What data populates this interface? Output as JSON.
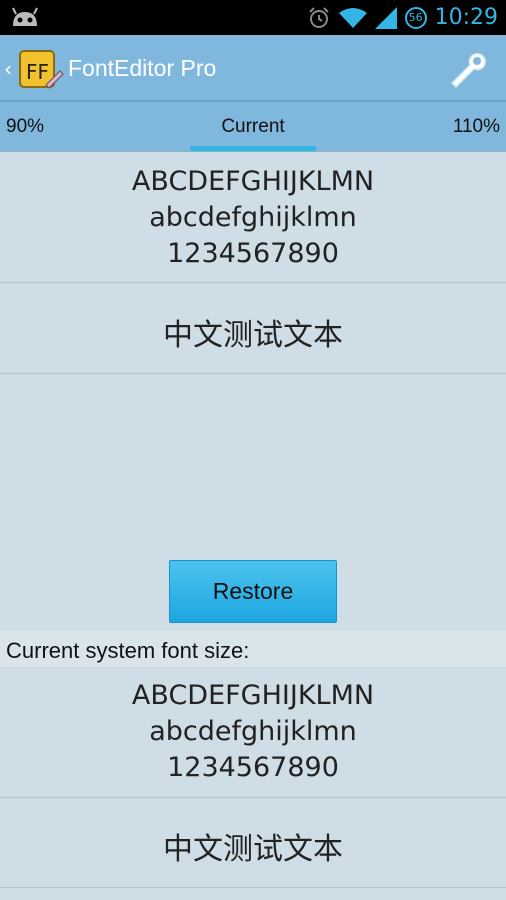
{
  "status_bar": {
    "time": "10:29",
    "battery_badge": "56",
    "icons": [
      "android-icon",
      "alarm-icon",
      "wifi-icon",
      "signal-icon",
      "battery-icon"
    ]
  },
  "action_bar": {
    "title": "FontEditor Pro",
    "logo_text": "FF",
    "icons": [
      "up-caret-icon",
      "app-logo-icon",
      "wrench-settings-icon"
    ]
  },
  "tabs": {
    "left": "90%",
    "center": "Current",
    "right": "110%",
    "accent_color": "#33b5e5"
  },
  "preview": {
    "uppercase": "ABCDEFGHIJKLMN",
    "lowercase": "abcdefghijklmn",
    "digits": "1234567890",
    "cjk": "中文测试文本"
  },
  "restore_button": "Restore",
  "system_section": {
    "header": "Current system font size:",
    "uppercase": "ABCDEFGHIJKLMN",
    "lowercase": "abcdefghijklmn",
    "digits": "1234567890",
    "cjk": "中文测试文本"
  }
}
